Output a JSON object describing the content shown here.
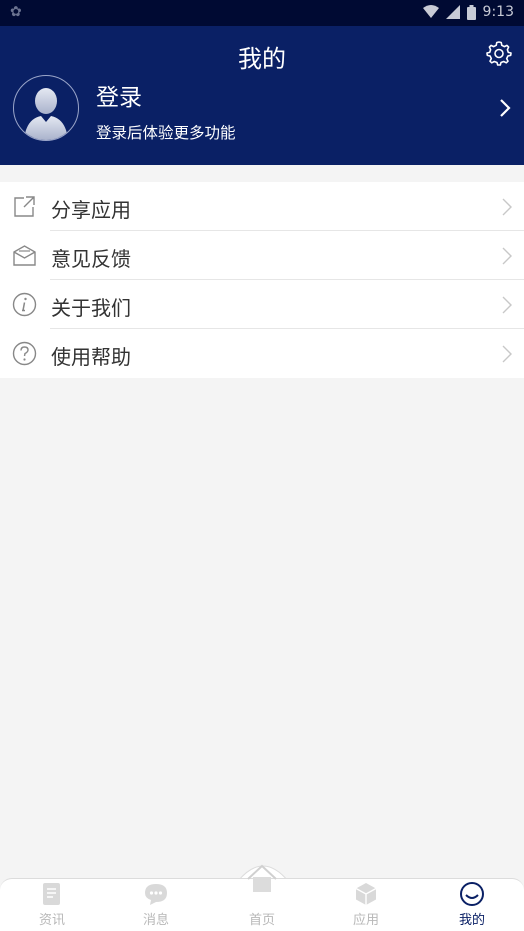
{
  "status_bar": {
    "time": "9:13"
  },
  "header": {
    "title": "我的",
    "login_title": "登录",
    "login_subtitle": "登录后体验更多功能"
  },
  "menu": [
    {
      "label": "分享应用",
      "icon": "share-icon"
    },
    {
      "label": "意见反馈",
      "icon": "feedback-icon"
    },
    {
      "label": "关于我们",
      "icon": "info-icon"
    },
    {
      "label": "使用帮助",
      "icon": "help-icon"
    }
  ],
  "tabbar": {
    "active": "我的",
    "tabs": [
      {
        "label": "资讯",
        "icon": "news-icon"
      },
      {
        "label": "消息",
        "icon": "message-icon"
      },
      {
        "label": "首页",
        "icon": "home-icon"
      },
      {
        "label": "应用",
        "icon": "apps-icon"
      },
      {
        "label": "我的",
        "icon": "profile-icon"
      }
    ]
  },
  "colors": {
    "header_bg": "#0a2065",
    "active_tab": "#0a2065",
    "inactive_tab": "#b8b8b8"
  }
}
